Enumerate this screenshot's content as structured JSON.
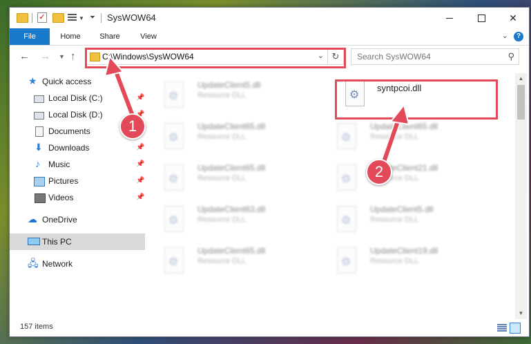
{
  "window": {
    "title": "SysWOW64"
  },
  "ribbon": {
    "tabs": [
      "File",
      "Home",
      "Share",
      "View"
    ],
    "help": "?"
  },
  "nav": {
    "address": "C:\\Windows\\SysWOW64",
    "search_placeholder": "Search SysWOW64"
  },
  "sidebar": {
    "items": [
      {
        "label": "Quick access",
        "icon": "star-icon",
        "pinned": false
      },
      {
        "label": "Local Disk (C:)",
        "icon": "drive-icon",
        "pinned": true
      },
      {
        "label": "Local Disk (D:)",
        "icon": "drive-icon",
        "pinned": true
      },
      {
        "label": "Documents",
        "icon": "documents-icon",
        "pinned": true
      },
      {
        "label": "Downloads",
        "icon": "download-icon",
        "pinned": true
      },
      {
        "label": "Music",
        "icon": "music-icon",
        "pinned": true
      },
      {
        "label": "Pictures",
        "icon": "pictures-icon",
        "pinned": true
      },
      {
        "label": "Videos",
        "icon": "videos-icon",
        "pinned": true
      },
      {
        "label": "OneDrive",
        "icon": "cloud-icon",
        "pinned": false
      },
      {
        "label": "This PC",
        "icon": "computer-icon",
        "pinned": false
      },
      {
        "label": "Network",
        "icon": "network-icon",
        "pinned": false
      }
    ]
  },
  "files": {
    "left": [
      {
        "name": "UpdateClient5.dll",
        "type": "Resource DLL"
      },
      {
        "name": "UpdateClient65.dll",
        "type": "Resource DLL"
      },
      {
        "name": "UpdateClient65.dll",
        "type": "Resource DLL"
      },
      {
        "name": "UpdateClient63.dll",
        "type": "Resource DLL"
      },
      {
        "name": "UpdateClient65.dll",
        "type": "Resource DLL"
      }
    ],
    "right": [
      {
        "name": "syntpcoi.dll",
        "type": ""
      },
      {
        "name": "UpdateClient65.dll",
        "type": "Resource DLL"
      },
      {
        "name": "UpdateClient21.dll",
        "type": "Resource DLL"
      },
      {
        "name": "UpdateClient5.dll",
        "type": "Resource DLL"
      },
      {
        "name": "UpdateClient19.dll",
        "type": "Resource DLL"
      }
    ]
  },
  "status": {
    "item_count": "157 items"
  },
  "callouts": {
    "one": "1",
    "two": "2"
  },
  "colors": {
    "accent": "#1979ca",
    "highlight": "#e24a5a"
  }
}
